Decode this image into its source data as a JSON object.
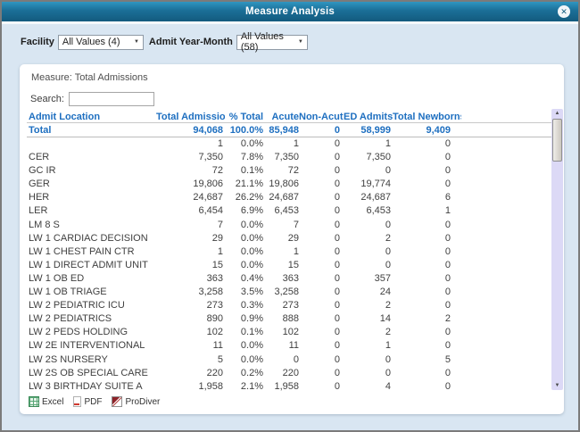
{
  "titlebar": {
    "title": "Measure Analysis"
  },
  "filters": {
    "facility_label": "Facility",
    "facility_value": "All Values (4)",
    "admit_label": "Admit Year-Month",
    "admit_value": "All Values (58)"
  },
  "panel": {
    "measure_label": "Measure: Total Admissions",
    "search_label": "Search:",
    "search_value": ""
  },
  "table": {
    "columns": [
      "Admit Location",
      "Total Admissions",
      "% Total",
      "Acute",
      "Non-Acute",
      "ED Admits",
      "Total Newborns"
    ],
    "total_row": [
      "Total",
      "94,068",
      "100.0%",
      "85,948",
      "0",
      "58,999",
      "9,409"
    ],
    "rows": [
      [
        "",
        "1",
        "0.0%",
        "1",
        "0",
        "1",
        "0"
      ],
      [
        "CER",
        "7,350",
        "7.8%",
        "7,350",
        "0",
        "7,350",
        "0"
      ],
      [
        "GC IR",
        "72",
        "0.1%",
        "72",
        "0",
        "0",
        "0"
      ],
      [
        "GER",
        "19,806",
        "21.1%",
        "19,806",
        "0",
        "19,774",
        "0"
      ],
      [
        "HER",
        "24,687",
        "26.2%",
        "24,687",
        "0",
        "24,687",
        "6"
      ],
      [
        "LER",
        "6,454",
        "6.9%",
        "6,453",
        "0",
        "6,453",
        "1"
      ],
      [
        "LM 8 S",
        "7",
        "0.0%",
        "7",
        "0",
        "0",
        "0"
      ],
      [
        "LW 1 CARDIAC DECISION",
        "29",
        "0.0%",
        "29",
        "0",
        "2",
        "0"
      ],
      [
        "LW 1 CHEST PAIN CTR",
        "1",
        "0.0%",
        "1",
        "0",
        "0",
        "0"
      ],
      [
        "LW 1 DIRECT ADMIT UNIT",
        "15",
        "0.0%",
        "15",
        "0",
        "0",
        "0"
      ],
      [
        "LW 1 OB ED",
        "363",
        "0.4%",
        "363",
        "0",
        "357",
        "0"
      ],
      [
        "LW 1 OB TRIAGE",
        "3,258",
        "3.5%",
        "3,258",
        "0",
        "24",
        "0"
      ],
      [
        "LW 2 PEDIATRIC ICU",
        "273",
        "0.3%",
        "273",
        "0",
        "2",
        "0"
      ],
      [
        "LW 2 PEDIATRICS",
        "890",
        "0.9%",
        "888",
        "0",
        "14",
        "2"
      ],
      [
        "LW 2 PEDS HOLDING",
        "102",
        "0.1%",
        "102",
        "0",
        "2",
        "0"
      ],
      [
        "LW 2E INTERVENTIONAL",
        "11",
        "0.0%",
        "11",
        "0",
        "1",
        "0"
      ],
      [
        "LW 2S NURSERY",
        "5",
        "0.0%",
        "0",
        "0",
        "0",
        "5"
      ],
      [
        "LW 2S OB SPECIAL CARE",
        "220",
        "0.2%",
        "220",
        "0",
        "0",
        "0"
      ],
      [
        "LW 3 BIRTHDAY SUITE A",
        "1,958",
        "2.1%",
        "1,958",
        "0",
        "4",
        "0"
      ]
    ]
  },
  "footer": {
    "links": [
      {
        "label": "Excel",
        "icon": "excel-icon"
      },
      {
        "label": "PDF",
        "icon": "pdf-icon"
      },
      {
        "label": "ProDiver",
        "icon": "prodiver-icon"
      }
    ]
  },
  "icons": {
    "close": "close-icon",
    "dropdown_arrow": "chevron-down-icon",
    "scroll_up": "scroll-up-arrow-icon",
    "scroll_down": "scroll-down-arrow-icon"
  },
  "colors": {
    "titlebar_top": "#3096c1",
    "titlebar_bottom": "#135a7e",
    "dialog_body": "#d9e6f2",
    "accent_blue_text": "#1e6fc0",
    "scroll_track": "#dcd9f6"
  }
}
